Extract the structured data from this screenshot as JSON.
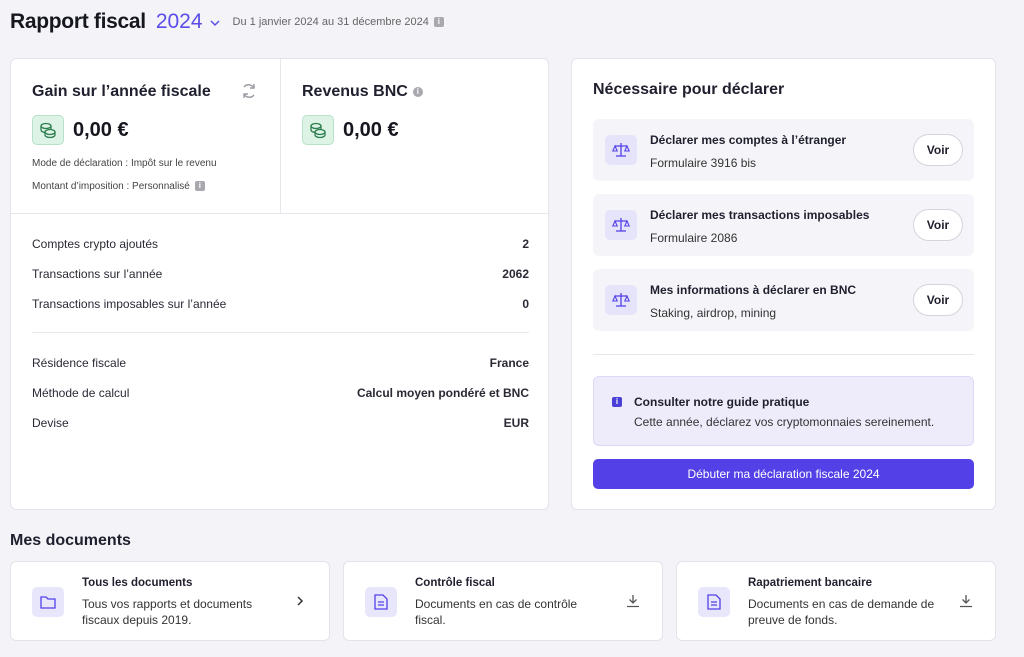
{
  "header": {
    "title": "Rapport fiscal",
    "year": "2024",
    "date_range": "Du 1 janvier 2024 au 31 décembre 2024"
  },
  "gain": {
    "title": "Gain sur l’année fiscale",
    "amount": "0,00 €",
    "mode": "Mode de déclaration : Impôt sur le revenu",
    "imposition": "Montant d’imposition : Personnalisé"
  },
  "bnc": {
    "title": "Revenus BNC",
    "amount": "0,00 €"
  },
  "stats": [
    {
      "label": "Comptes crypto ajoutés",
      "value": "2"
    },
    {
      "label": "Transactions sur l’année",
      "value": "2062"
    },
    {
      "label": "Transactions imposables sur l’année",
      "value": "0"
    }
  ],
  "settings": [
    {
      "label": "Résidence fiscale",
      "value": "France"
    },
    {
      "label": "Méthode de calcul",
      "value": "Calcul moyen pondéré et BNC"
    },
    {
      "label": "Devise",
      "value": "EUR"
    }
  ],
  "necessary": {
    "title": "Nécessaire pour déclarer",
    "items": [
      {
        "title": "Déclarer mes comptes à l’étranger",
        "subtitle": "Formulaire 3916 bis",
        "button": "Voir"
      },
      {
        "title": "Déclarer mes transactions imposables",
        "subtitle": "Formulaire 2086",
        "button": "Voir"
      },
      {
        "title": "Mes informations à déclarer en BNC",
        "subtitle": "Staking, airdrop, mining",
        "button": "Voir"
      }
    ],
    "guide_title": "Consulter notre guide pratique",
    "guide_text": "Cette année, déclarez vos cryptomonnaies sereinement.",
    "cta": "Débuter ma déclaration fiscale 2024"
  },
  "documents": {
    "title": "Mes documents",
    "cards": [
      {
        "title": "Tous les documents",
        "text": "Tous vos rapports et documents fiscaux depuis 2019.",
        "icon": "folder-icon",
        "action": "chevron-right-icon"
      },
      {
        "title": "Contrôle fiscal",
        "text": "Documents en cas de contrôle fiscal.",
        "icon": "document-icon",
        "action": "download-icon"
      },
      {
        "title": "Rapatriement bancaire",
        "text": "Documents en cas de demande de preuve de fonds.",
        "icon": "document-icon",
        "action": "download-icon"
      }
    ]
  },
  "colors": {
    "accent": "#5340e6",
    "coin_bg": "#dcf3e6",
    "page_bg": "#f3f3f8"
  }
}
